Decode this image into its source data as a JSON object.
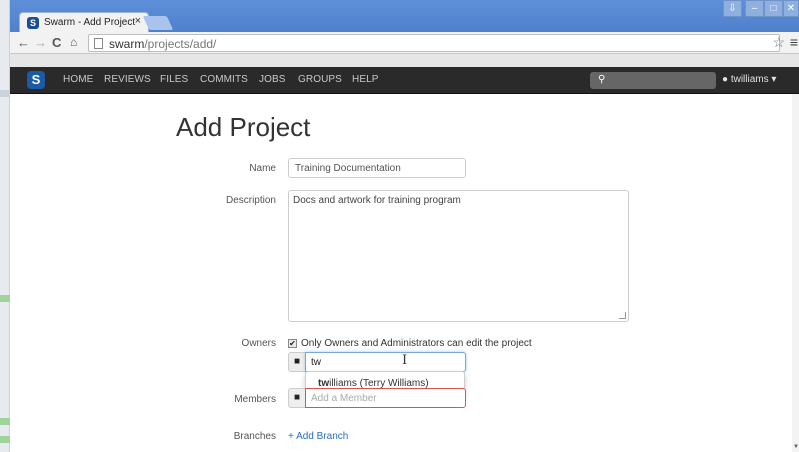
{
  "browser": {
    "tab_title": "Swarm - Add Project",
    "tab_close": "×",
    "favicon_letter": "S",
    "url_host": "swarm",
    "url_path": "/projects/add/",
    "window_controls": [
      "⇩",
      "–",
      "□",
      "✕"
    ]
  },
  "navbar": {
    "brand": "S",
    "links": [
      "HOME",
      "REVIEWS",
      "FILES",
      "COMMITS",
      "JOBS",
      "GROUPS",
      "HELP"
    ],
    "user": "twilliams",
    "user_caret": "▾"
  },
  "form": {
    "title": "Add Project",
    "name_label": "Name",
    "name_value": "Training Documentation",
    "description_label": "Description",
    "description_value": "Docs and artwork for training program",
    "owners_label": "Owners",
    "owners_checkbox_label": "Only Owners and Administrators can edit the project",
    "owners_checkbox_checked": true,
    "owners_input_value": "tw",
    "typeahead_match": "tw",
    "typeahead_rest": "illiams (Terry Williams)",
    "members_label": "Members",
    "members_placeholder": "Add a Member",
    "branches_label": "Branches",
    "add_branch": "+ Add Branch"
  },
  "colors": {
    "navbar_bg": "#2a2a2a",
    "brand_blue": "#1a5aa6",
    "link_blue": "#2a6bcc",
    "error_red": "#d9534f"
  }
}
